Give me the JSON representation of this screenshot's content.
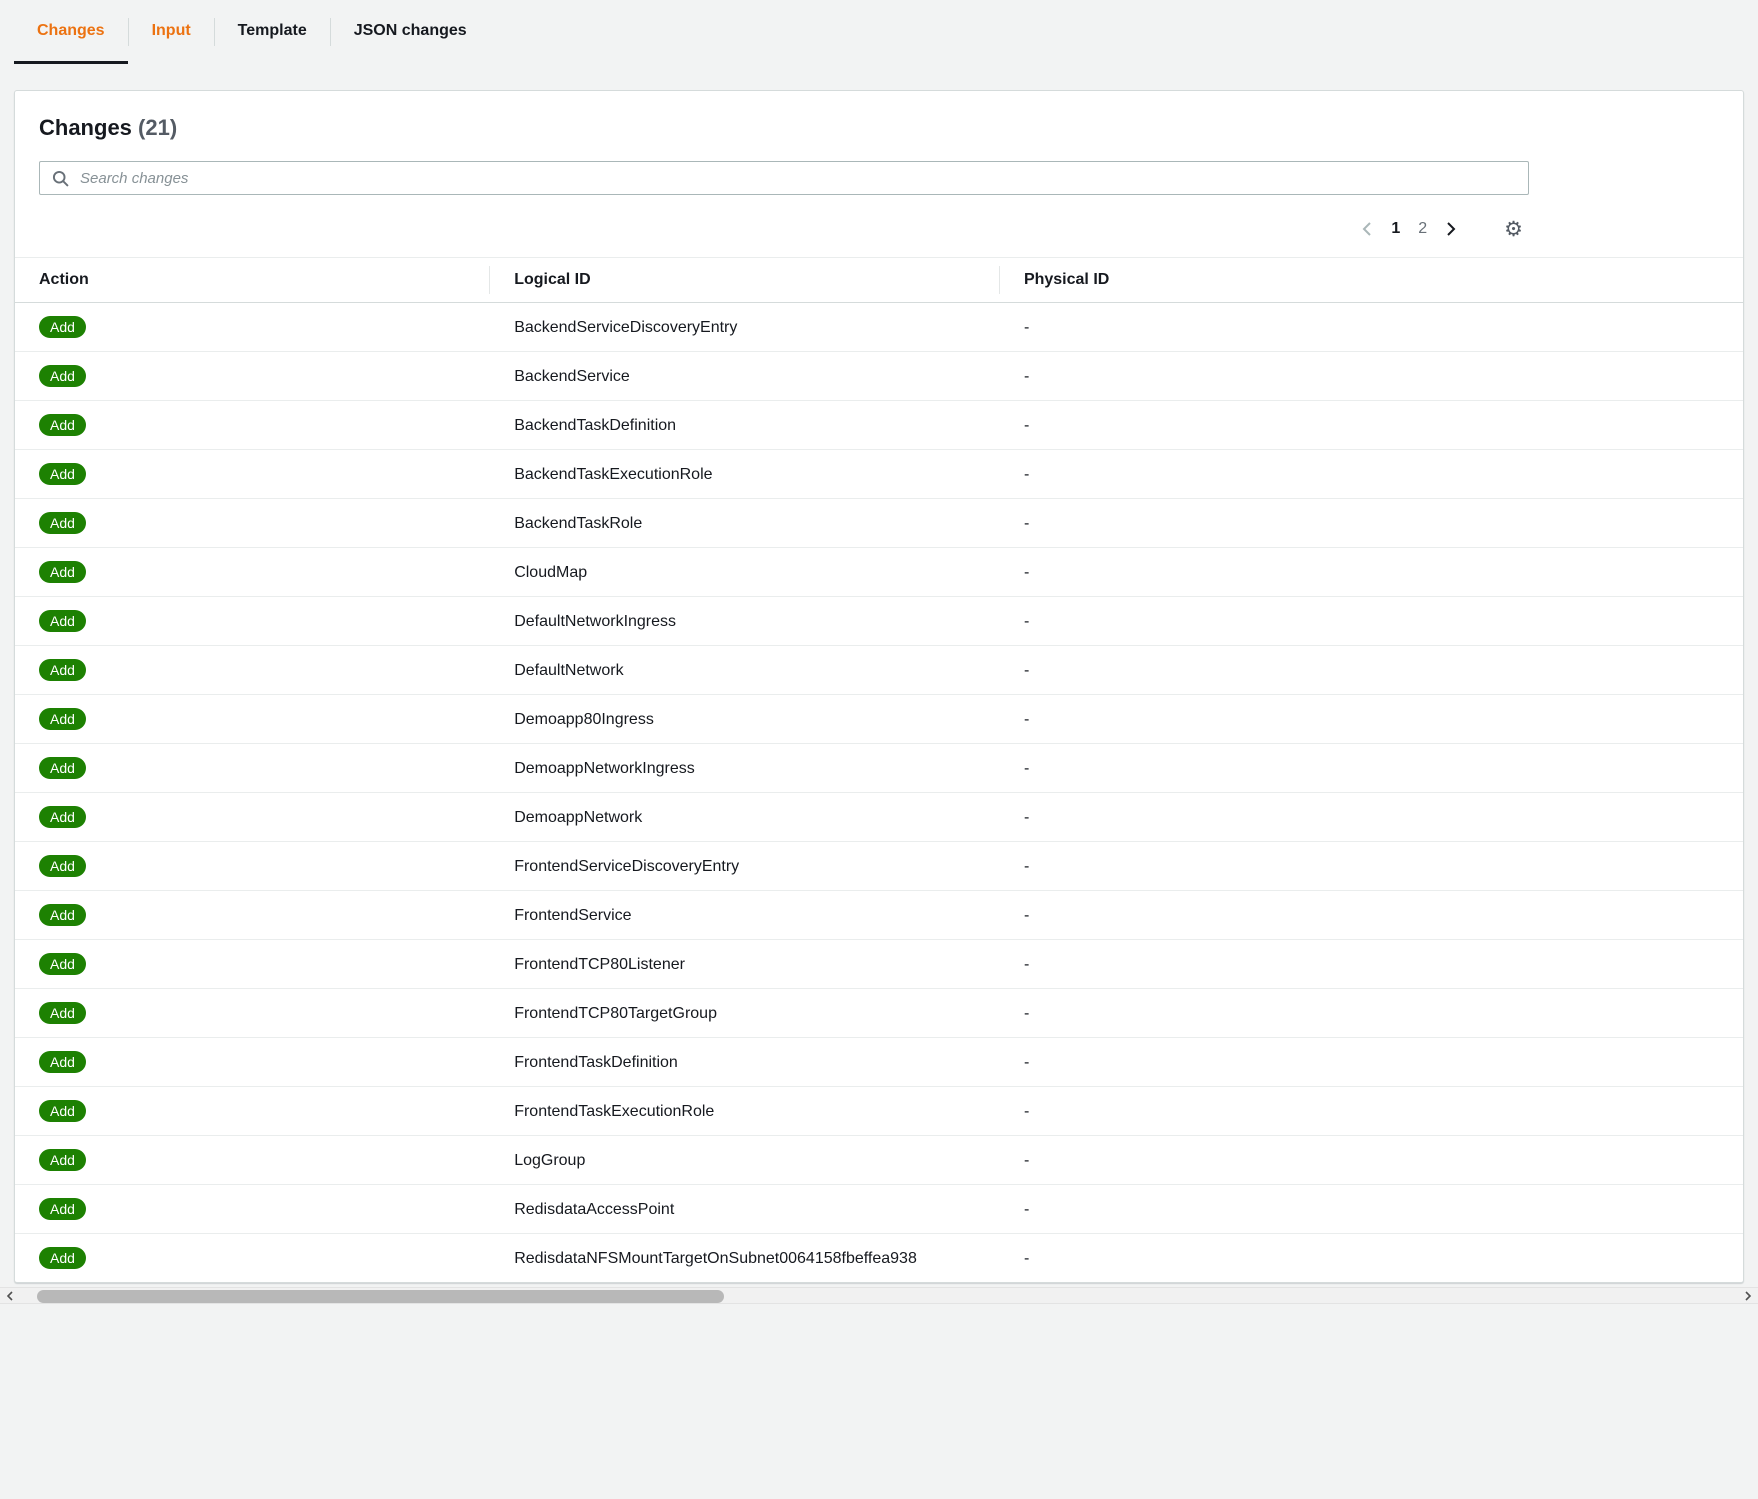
{
  "tabs": [
    {
      "label": "Changes",
      "active": true
    },
    {
      "label": "Input",
      "active": false
    },
    {
      "label": "Template",
      "active": false
    },
    {
      "label": "JSON changes",
      "active": false
    }
  ],
  "panel": {
    "title": "Changes",
    "count": "(21)",
    "search": {
      "placeholder": "Search changes",
      "value": ""
    },
    "pagination": {
      "current_page": "1",
      "pages": [
        "1",
        "2"
      ]
    }
  },
  "table": {
    "columns": [
      "Action",
      "Logical ID",
      "Physical ID"
    ],
    "rows": [
      {
        "action": "Add",
        "logical_id": "BackendServiceDiscoveryEntry",
        "physical_id": "-"
      },
      {
        "action": "Add",
        "logical_id": "BackendService",
        "physical_id": "-"
      },
      {
        "action": "Add",
        "logical_id": "BackendTaskDefinition",
        "physical_id": "-"
      },
      {
        "action": "Add",
        "logical_id": "BackendTaskExecutionRole",
        "physical_id": "-"
      },
      {
        "action": "Add",
        "logical_id": "BackendTaskRole",
        "physical_id": "-"
      },
      {
        "action": "Add",
        "logical_id": "CloudMap",
        "physical_id": "-"
      },
      {
        "action": "Add",
        "logical_id": "DefaultNetworkIngress",
        "physical_id": "-"
      },
      {
        "action": "Add",
        "logical_id": "DefaultNetwork",
        "physical_id": "-"
      },
      {
        "action": "Add",
        "logical_id": "Demoapp80Ingress",
        "physical_id": "-"
      },
      {
        "action": "Add",
        "logical_id": "DemoappNetworkIngress",
        "physical_id": "-"
      },
      {
        "action": "Add",
        "logical_id": "DemoappNetwork",
        "physical_id": "-"
      },
      {
        "action": "Add",
        "logical_id": "FrontendServiceDiscoveryEntry",
        "physical_id": "-"
      },
      {
        "action": "Add",
        "logical_id": "FrontendService",
        "physical_id": "-"
      },
      {
        "action": "Add",
        "logical_id": "FrontendTCP80Listener",
        "physical_id": "-"
      },
      {
        "action": "Add",
        "logical_id": "FrontendTCP80TargetGroup",
        "physical_id": "-"
      },
      {
        "action": "Add",
        "logical_id": "FrontendTaskDefinition",
        "physical_id": "-"
      },
      {
        "action": "Add",
        "logical_id": "FrontendTaskExecutionRole",
        "physical_id": "-"
      },
      {
        "action": "Add",
        "logical_id": "LogGroup",
        "physical_id": "-"
      },
      {
        "action": "Add",
        "logical_id": "RedisdataAccessPoint",
        "physical_id": "-"
      },
      {
        "action": "Add",
        "logical_id": "RedisdataNFSMountTargetOnSubnet0064158fbeffea938",
        "physical_id": "-"
      }
    ]
  },
  "icons": {
    "gear": "⚙"
  },
  "colors": {
    "accent_orange": "#ec7211",
    "badge_green": "#1d8102",
    "text_dark": "#16191f",
    "text_gray": "#687078",
    "border_light": "#eaeded",
    "page_background": "#f2f3f3"
  }
}
